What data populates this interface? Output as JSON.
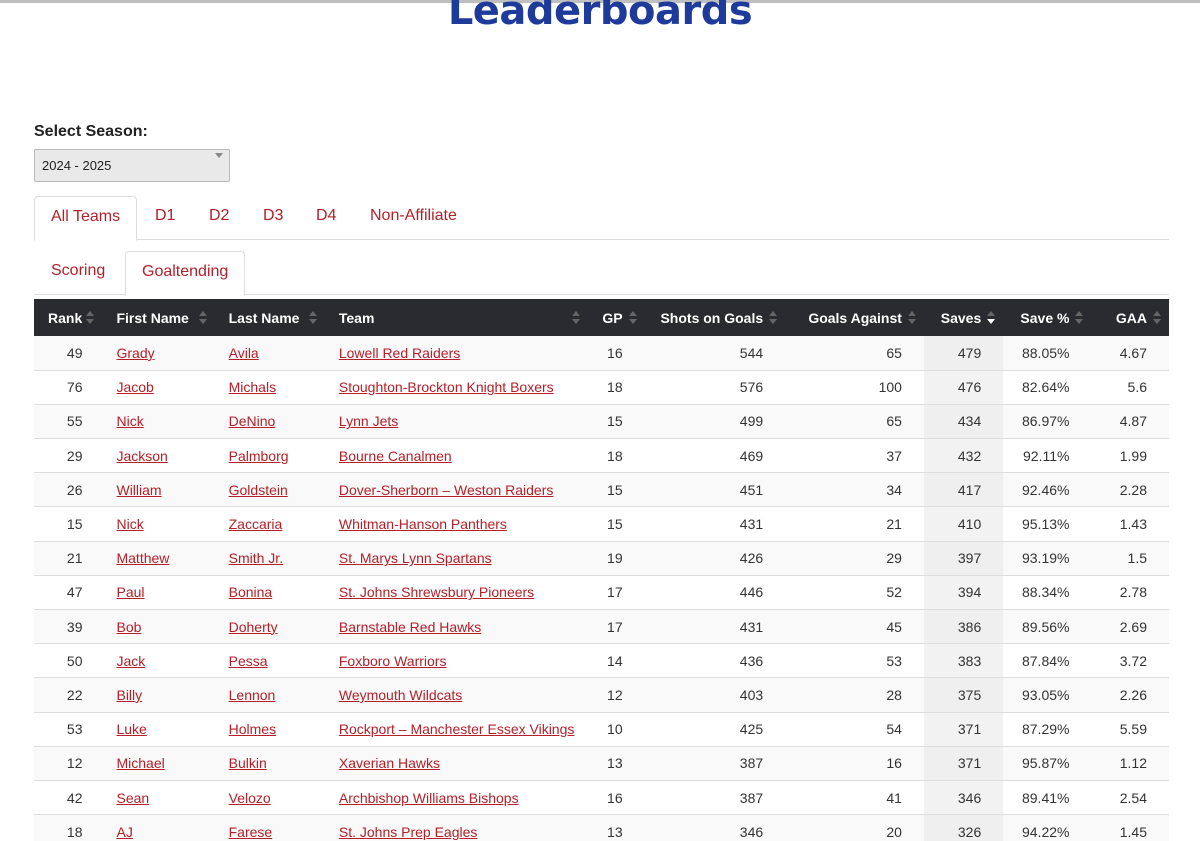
{
  "page": {
    "title": "Leaderboards"
  },
  "season": {
    "label": "Select Season:",
    "selected": "2024 - 2025"
  },
  "division_tabs": [
    {
      "label": "All Teams",
      "active": true
    },
    {
      "label": "D1",
      "active": false
    },
    {
      "label": "D2",
      "active": false
    },
    {
      "label": "D3",
      "active": false
    },
    {
      "label": "D4",
      "active": false
    },
    {
      "label": "Non-Affiliate",
      "active": false
    }
  ],
  "stat_tabs": [
    {
      "label": "Scoring",
      "active": false
    },
    {
      "label": "Goaltending",
      "active": true
    }
  ],
  "table": {
    "sorted_column": "Saves",
    "sort_direction": "descending",
    "columns": [
      "Rank",
      "First Name",
      "Last Name",
      "Team",
      "GP",
      "Shots on Goals",
      "Goals Against",
      "Saves",
      "Save %",
      "GAA"
    ],
    "rows": [
      [
        "49",
        "Grady",
        "Avila",
        "Lowell Red Raiders",
        "16",
        "544",
        "65",
        "479",
        "88.05%",
        "4.67"
      ],
      [
        "76",
        "Jacob",
        "Michals",
        "Stoughton-Brockton Knight Boxers",
        "18",
        "576",
        "100",
        "476",
        "82.64%",
        "5.6"
      ],
      [
        "55",
        "Nick",
        "DeNino",
        "Lynn Jets",
        "15",
        "499",
        "65",
        "434",
        "86.97%",
        "4.87"
      ],
      [
        "29",
        "Jackson",
        "Palmborg",
        "Bourne Canalmen",
        "18",
        "469",
        "37",
        "432",
        "92.11%",
        "1.99"
      ],
      [
        "26",
        "William",
        "Goldstein",
        "Dover-Sherborn – Weston Raiders",
        "15",
        "451",
        "34",
        "417",
        "92.46%",
        "2.28"
      ],
      [
        "15",
        "Nick",
        "Zaccaria",
        "Whitman-Hanson Panthers",
        "15",
        "431",
        "21",
        "410",
        "95.13%",
        "1.43"
      ],
      [
        "21",
        "Matthew",
        "Smith Jr.",
        "St. Marys Lynn Spartans",
        "19",
        "426",
        "29",
        "397",
        "93.19%",
        "1.5"
      ],
      [
        "47",
        "Paul",
        "Bonina",
        "St. Johns Shrewsbury Pioneers",
        "17",
        "446",
        "52",
        "394",
        "88.34%",
        "2.78"
      ],
      [
        "39",
        "Bob",
        "Doherty",
        "Barnstable Red Hawks",
        "17",
        "431",
        "45",
        "386",
        "89.56%",
        "2.69"
      ],
      [
        "50",
        "Jack",
        "Pessa",
        "Foxboro Warriors",
        "14",
        "436",
        "53",
        "383",
        "87.84%",
        "3.72"
      ],
      [
        "22",
        "Billy",
        "Lennon",
        "Weymouth Wildcats",
        "12",
        "403",
        "28",
        "375",
        "93.05%",
        "2.26"
      ],
      [
        "53",
        "Luke",
        "Holmes",
        "Rockport – Manchester Essex Vikings",
        "10",
        "425",
        "54",
        "371",
        "87.29%",
        "5.59"
      ],
      [
        "12",
        "Michael",
        "Bulkin",
        "Xaverian Hawks",
        "13",
        "387",
        "16",
        "371",
        "95.87%",
        "1.12"
      ],
      [
        "42",
        "Sean",
        "Velozo",
        "Archbishop Williams Bishops",
        "16",
        "387",
        "41",
        "346",
        "89.41%",
        "2.54"
      ],
      [
        "18",
        "AJ",
        "Farese",
        "St. Johns Prep Eagles",
        "13",
        "346",
        "20",
        "326",
        "94.22%",
        "1.45"
      ]
    ]
  },
  "colors": {
    "title": "#1e3a9a",
    "link": "#b3202a",
    "header_bg": "#2a2b31"
  }
}
